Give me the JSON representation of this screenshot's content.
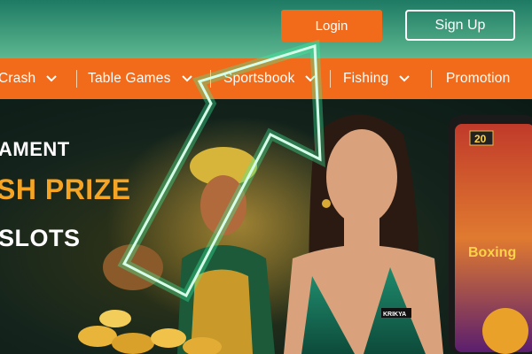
{
  "header": {
    "login_label": "Login",
    "signup_label": "Sign Up"
  },
  "nav": {
    "items": [
      {
        "label": "Crash",
        "icon": "chevron-down-icon"
      },
      {
        "label": "Table Games",
        "icon": "chevron-down-icon"
      },
      {
        "label": "Sportsbook",
        "icon": "chevron-down-icon"
      },
      {
        "label": "Fishing",
        "icon": "chevron-down-icon"
      },
      {
        "label": "Promotion"
      }
    ]
  },
  "banner": {
    "line1": "AMENT",
    "line2": "SH PRIZE",
    "line3": "SLOTS",
    "phone_badge": "20",
    "phone_game": "Boxing",
    "dress_logo": "KRIKYA"
  },
  "colors": {
    "header_gradient_top": "#1e7a63",
    "header_gradient_bottom": "#5db890",
    "accent_orange": "#f26b1a",
    "prize_gold": "#f6a423",
    "arrow_glow": "#39f5a0"
  }
}
